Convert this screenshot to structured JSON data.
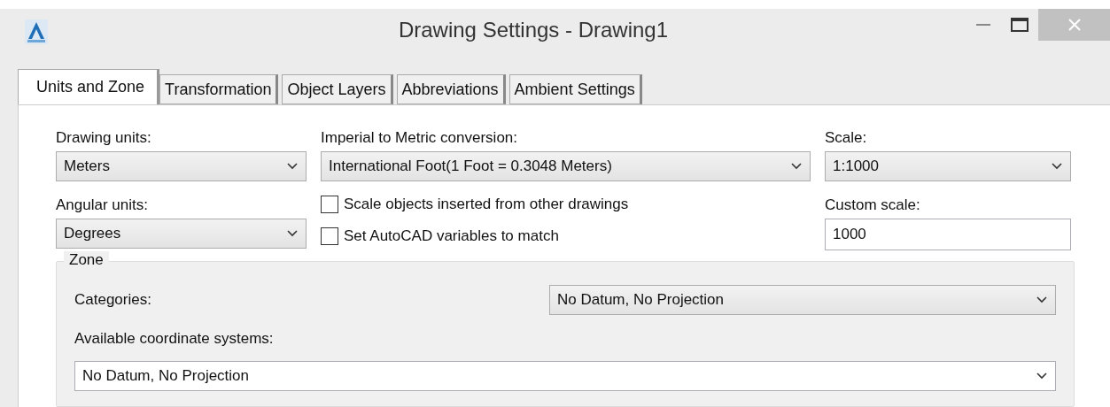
{
  "window": {
    "title": "Drawing Settings - Drawing1"
  },
  "tabs": [
    {
      "label": "Units and Zone",
      "selected": true
    },
    {
      "label": "Transformation",
      "selected": false
    },
    {
      "label": "Object Layers",
      "selected": false
    },
    {
      "label": "Abbreviations",
      "selected": false
    },
    {
      "label": "Ambient Settings",
      "selected": false
    }
  ],
  "drawing_units": {
    "label": "Drawing units:",
    "value": "Meters"
  },
  "angular_units": {
    "label": "Angular units:",
    "value": "Degrees"
  },
  "conversion": {
    "label": "Imperial to Metric conversion:",
    "value": "International Foot(1 Foot = 0.3048 Meters)"
  },
  "options": [
    {
      "label": "Scale objects inserted from other drawings",
      "checked": false
    },
    {
      "label": "Set AutoCAD variables to match",
      "checked": false
    }
  ],
  "scale": {
    "label": "Scale:",
    "value": "1:1000"
  },
  "custom_scale": {
    "label": "Custom scale:",
    "value": "1000"
  },
  "zone": {
    "title": "Zone",
    "categories": {
      "label": "Categories:",
      "value": "No Datum, No Projection"
    },
    "coordinate_systems": {
      "label": "Available coordinate systems:",
      "value": "No Datum, No Projection"
    }
  }
}
